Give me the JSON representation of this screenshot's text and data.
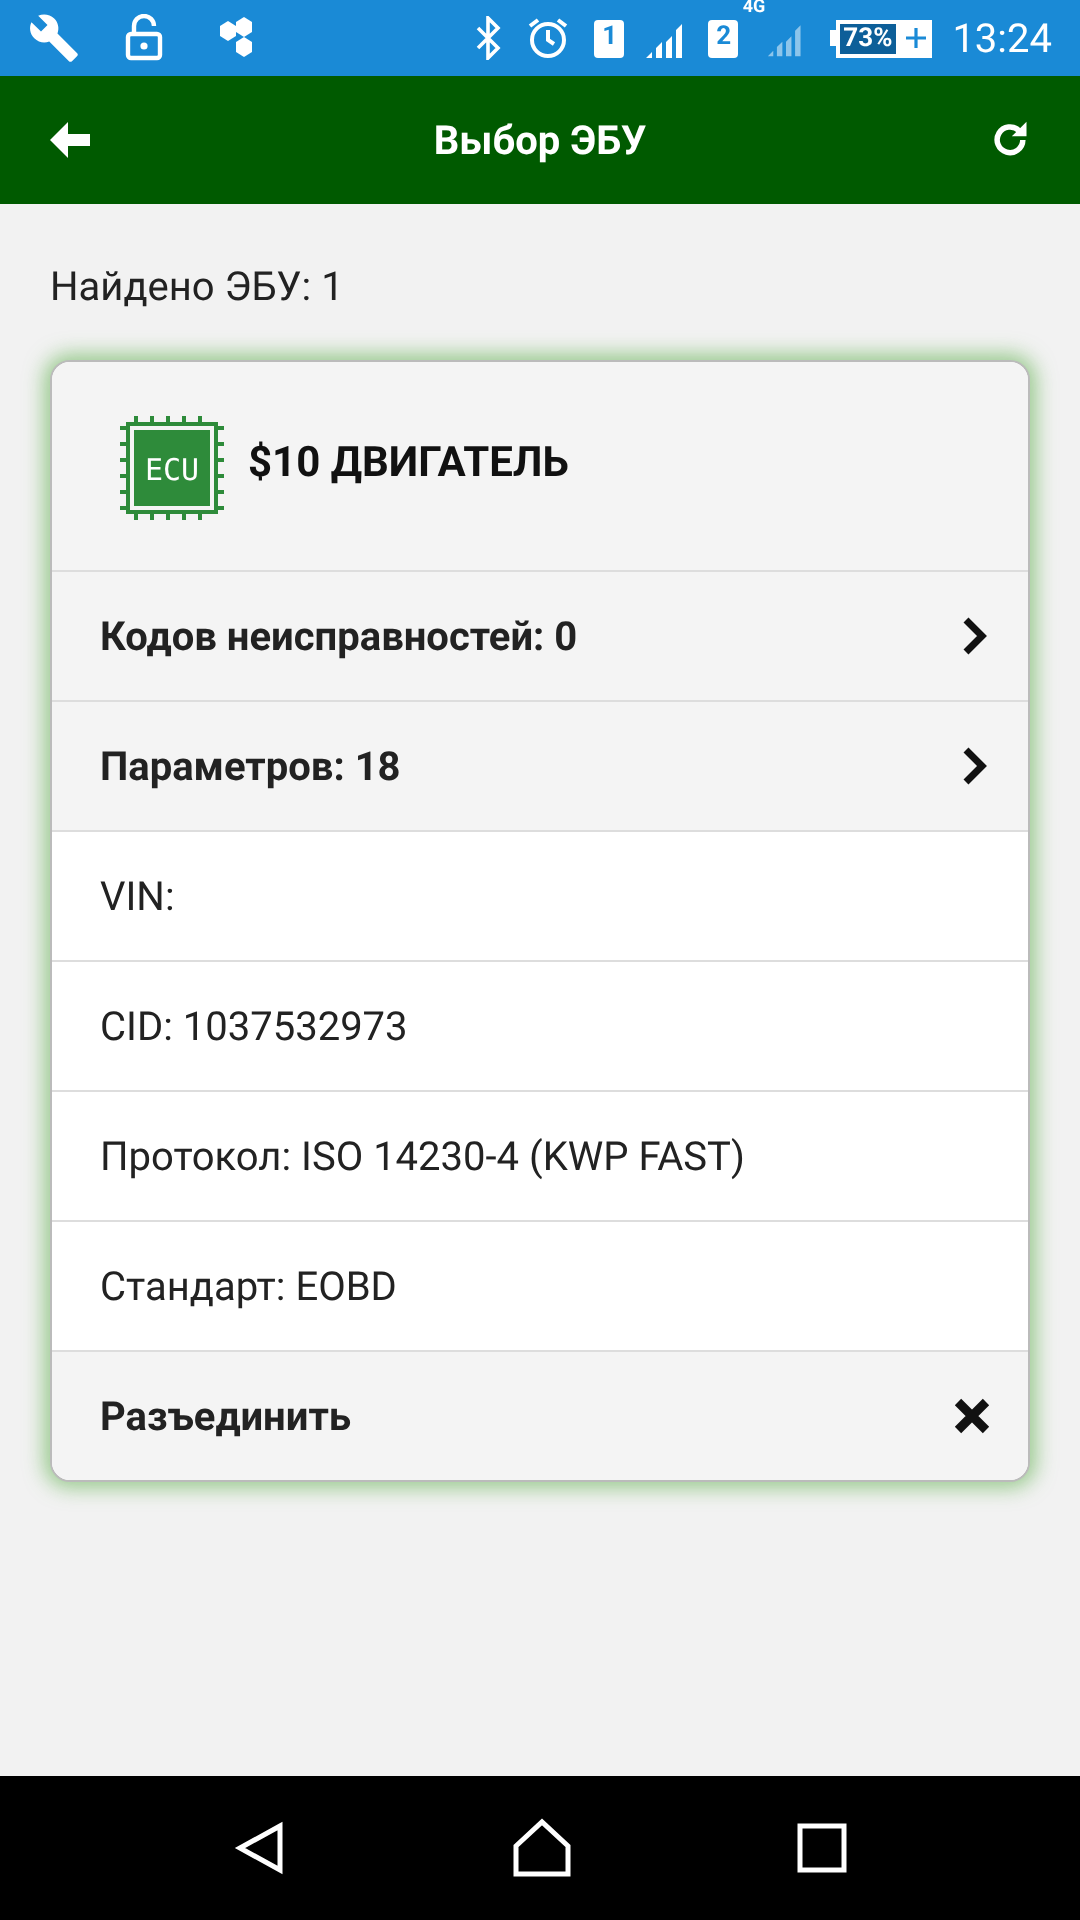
{
  "status_bar": {
    "sim1": "1",
    "sim2": "2",
    "network": "4G",
    "battery": "73%",
    "time": "13:24"
  },
  "app_bar": {
    "title": "Выбор ЭБУ"
  },
  "found": "Найдено ЭБУ: 1",
  "ecu": {
    "icon_label": "ECU",
    "title": "$10 ДВИГАТЕЛЬ",
    "rows": [
      {
        "kind": "link",
        "label": "Кодов неисправностей: 0"
      },
      {
        "kind": "link",
        "label": "Параметров: 18"
      },
      {
        "kind": "info",
        "label": "VIN:"
      },
      {
        "kind": "info",
        "label": "CID: 1037532973"
      },
      {
        "kind": "info",
        "label": "Протокол: ISO 14230-4 (KWP FAST)"
      },
      {
        "kind": "info",
        "label": "Стандарт: EOBD"
      },
      {
        "kind": "action",
        "label": "Разъединить"
      }
    ]
  }
}
